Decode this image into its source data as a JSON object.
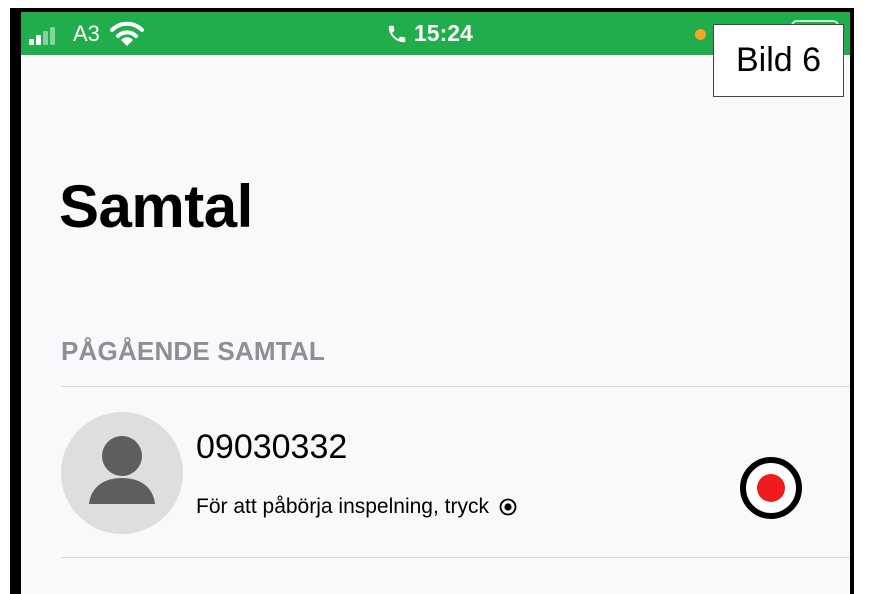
{
  "status_bar": {
    "carrier": "A3",
    "time": "15:24",
    "color": "#21ad4b",
    "icons": [
      "signal-icon",
      "wifi-icon",
      "phone-icon",
      "orange-dot-indicator",
      "battery-icon"
    ]
  },
  "overlay_label": "Bild 6",
  "page": {
    "title": "Samtal",
    "section_header": "PÅGÅENDE SAMTAL"
  },
  "call": {
    "number": "09030332",
    "hint": "För att påbörja inspelning, tryck",
    "avatar_icon": "person-icon",
    "record_icon": "record-icon",
    "record_color": "#ee1c1c"
  }
}
